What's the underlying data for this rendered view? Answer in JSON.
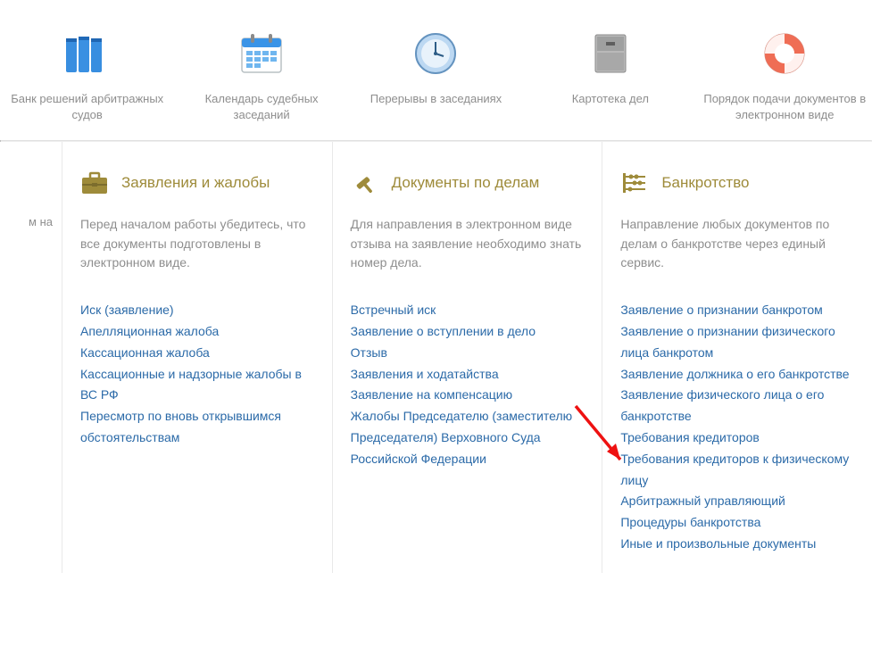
{
  "top_items": [
    {
      "label": "Банк решений арбитражных судов",
      "icon": "folders-icon"
    },
    {
      "label": "Календарь судебных заседаний",
      "icon": "calendar-icon"
    },
    {
      "label": "Перерывы в заседаниях",
      "icon": "clock-icon"
    },
    {
      "label": "Картотека дел",
      "icon": "cabinet-icon"
    },
    {
      "label": "Порядок подачи документов в электронном виде",
      "icon": "lifebuoy-icon"
    }
  ],
  "left_stub": "м на \n",
  "columns": [
    {
      "title": "Заявления и жалобы",
      "icon": "briefcase-icon",
      "desc": "Перед началом работы убедитесь, что все документы подготовлены в электронном виде.",
      "links": [
        "Иск (заявление)",
        "Апелляционная жалоба",
        "Кассационная жалоба",
        "Кассационные и надзорные жалобы в ВС РФ",
        "Пересмотр по вновь открывшимся обстоятельствам"
      ]
    },
    {
      "title": "Документы по делам",
      "icon": "gavel-icon",
      "desc": "Для направления в электронном виде отзыва на заявление необходимо знать номер дела.",
      "links": [
        "Встречный иск",
        "Заявление о вступлении в дело",
        "Отзыв",
        "Заявления и ходатайства",
        "Заявление на компенсацию",
        "Жалобы Председателю (заместителю Председателя) Верховного Суда Российской Федерации"
      ]
    },
    {
      "title": "Банкротство",
      "icon": "abacus-icon",
      "desc": "Направление любых документов по делам о банкротстве через единый сервис.",
      "links": [
        "Заявление о признании банкротом",
        "Заявление о признании физического лица банкротом",
        "Заявление должника о его банкротстве",
        "Заявление физического лица о его банкротстве",
        "Требования кредиторов",
        "Требования кредиторов к физическому лицу",
        "Арбитражный управляющий",
        "Процедуры банкротства",
        "Иные и произвольные документы"
      ]
    }
  ]
}
